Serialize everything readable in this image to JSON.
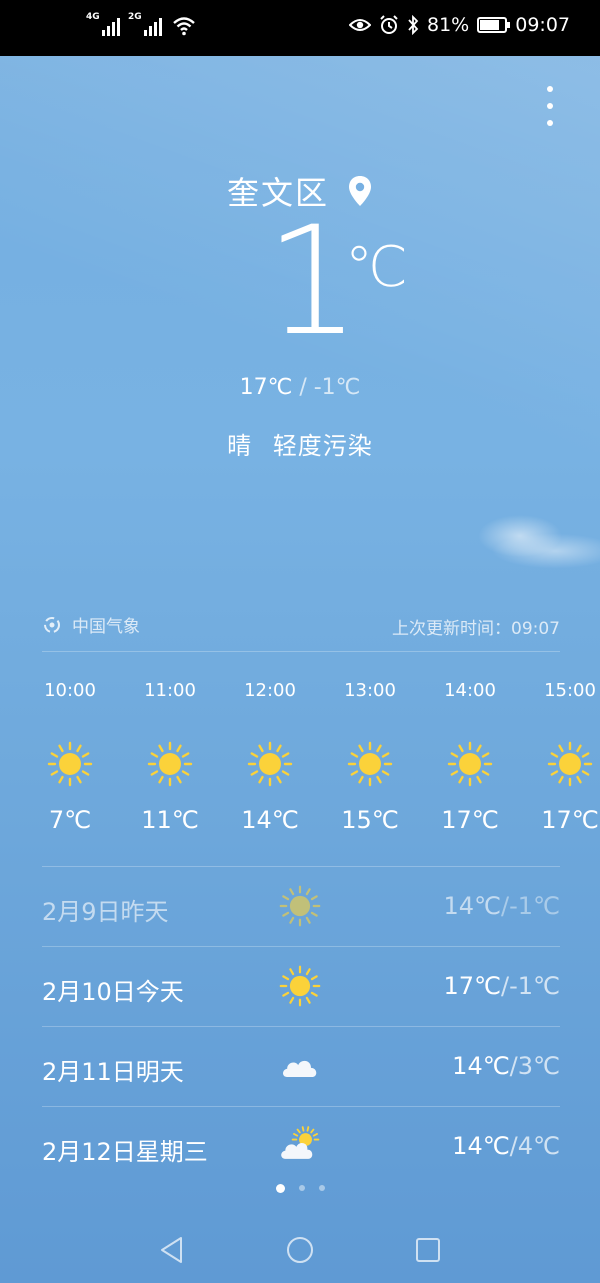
{
  "status_bar": {
    "network1": "4G",
    "network2": "2G",
    "battery": "81%",
    "battery_level": 0.81,
    "time": "09:07"
  },
  "header": {
    "city": "奎文区",
    "menu_icon": "more-vert-icon",
    "location_icon": "location-pin-icon"
  },
  "current": {
    "temp": "1",
    "unit": "℃",
    "high": "17℃",
    "sep": "/",
    "low": "-1℃",
    "condition": "晴",
    "air_quality": "轻度污染"
  },
  "source": {
    "provider": "中国气象",
    "update_label": "上次更新时间：09:07"
  },
  "hourly": [
    {
      "time": "10:00",
      "temp": "7℃",
      "icon": "sun-icon"
    },
    {
      "time": "11:00",
      "temp": "11℃",
      "icon": "sun-icon"
    },
    {
      "time": "12:00",
      "temp": "14℃",
      "icon": "sun-icon"
    },
    {
      "time": "13:00",
      "temp": "15℃",
      "icon": "sun-icon"
    },
    {
      "time": "14:00",
      "temp": "17℃",
      "icon": "sun-icon"
    },
    {
      "time": "15:00",
      "temp": "17℃",
      "icon": "sun-icon"
    }
  ],
  "daily": [
    {
      "label": "2月9日昨天",
      "high": "14℃",
      "low": "-1℃",
      "icon": "sun-icon"
    },
    {
      "label": "2月10日今天",
      "high": "17℃",
      "low": "-1℃",
      "icon": "sun-icon"
    },
    {
      "label": "2月11日明天",
      "high": "14℃",
      "low": "3℃",
      "icon": "cloud-icon"
    },
    {
      "label": "2月12日星期三",
      "high": "14℃",
      "low": "4℃",
      "icon": "partly-cloudy-icon"
    }
  ],
  "colors": {
    "sun": "#fbd23a",
    "cloud": "#ffffff"
  }
}
